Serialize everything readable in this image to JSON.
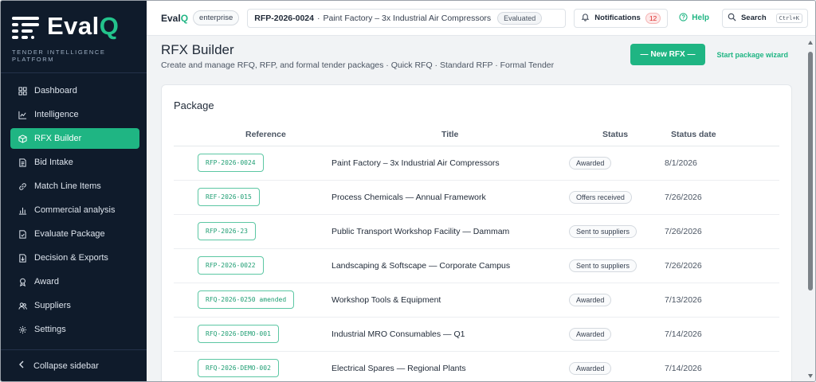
{
  "brand": {
    "logo_main": "Eval",
    "logo_accent": "Q",
    "tagline": "TENDER INTELLIGENCE PLATFORM"
  },
  "sidebar": {
    "items": [
      {
        "label": "Dashboard",
        "icon": "grid-icon"
      },
      {
        "label": "Intelligence",
        "icon": "chart-line-icon"
      },
      {
        "label": "RFX Builder",
        "icon": "cube-icon",
        "active": true
      },
      {
        "label": "Bid Intake",
        "icon": "document-icon"
      },
      {
        "label": "Match Line Items",
        "icon": "link-icon"
      },
      {
        "label": "Commercial analysis",
        "icon": "bar-chart-icon"
      },
      {
        "label": "Evaluate Package",
        "icon": "file-check-icon"
      },
      {
        "label": "Decision & Exports",
        "icon": "file-export-icon"
      },
      {
        "label": "Award",
        "icon": "award-icon"
      },
      {
        "label": "Suppliers",
        "icon": "users-icon"
      },
      {
        "label": "Settings",
        "icon": "gear-icon"
      }
    ],
    "collapse_label": "Collapse sidebar"
  },
  "topbar": {
    "app_name_main": "Eval",
    "app_name_accent": "Q",
    "tier": "enterprise",
    "context_ref": "RFP-2026-0024",
    "context_sep": "·",
    "context_title": "Paint Factory – 3x Industrial Air Compressors",
    "context_state": "Evaluated",
    "notifications_label": "Notifications",
    "notifications_count": "12",
    "help_label": "Help",
    "search_label": "Search",
    "search_shortcut": "Ctrl+K"
  },
  "header": {
    "title": "RFX Builder",
    "subtitle": "Create and manage RFQ, RFP, and formal tender packages · Quick RFQ · Standard RFP · Formal Tender",
    "new_button": "— New RFX —",
    "wizard_link": "Start package wizard"
  },
  "card": {
    "title": "Package",
    "columns": [
      "Reference",
      "Title",
      "Status",
      "Status date"
    ],
    "rows": [
      {
        "ref": "RFP-2026-0024",
        "title": "Paint Factory – 3x Industrial Air Compressors",
        "status": "Awarded",
        "date": "8/1/2026"
      },
      {
        "ref": "REF-2026-015",
        "title": "Process Chemicals — Annual Framework",
        "status": "Offers received",
        "date": "7/26/2026"
      },
      {
        "ref": "RFP-2026-23",
        "title": "Public Transport Workshop Facility — Dammam",
        "status": "Sent to suppliers",
        "date": "7/26/2026"
      },
      {
        "ref": "RFP-2026-0022",
        "title": "Landscaping & Softscape — Corporate Campus",
        "status": "Sent to suppliers",
        "date": "7/26/2026"
      },
      {
        "ref": "RFQ-2026-0250 amended",
        "title": "Workshop Tools & Equipment",
        "status": "Awarded",
        "date": "7/13/2026"
      },
      {
        "ref": "RFQ-2026-DEMO-001",
        "title": "Industrial MRO Consumables — Q1",
        "status": "Awarded",
        "date": "7/14/2026"
      },
      {
        "ref": "RFQ-2026-DEMO-002",
        "title": "Electrical Spares — Regional Plants",
        "status": "Awarded",
        "date": "7/14/2026"
      }
    ]
  },
  "colors": {
    "accent": "#1fb583",
    "sidebar_bg": "#0f1b2b"
  }
}
